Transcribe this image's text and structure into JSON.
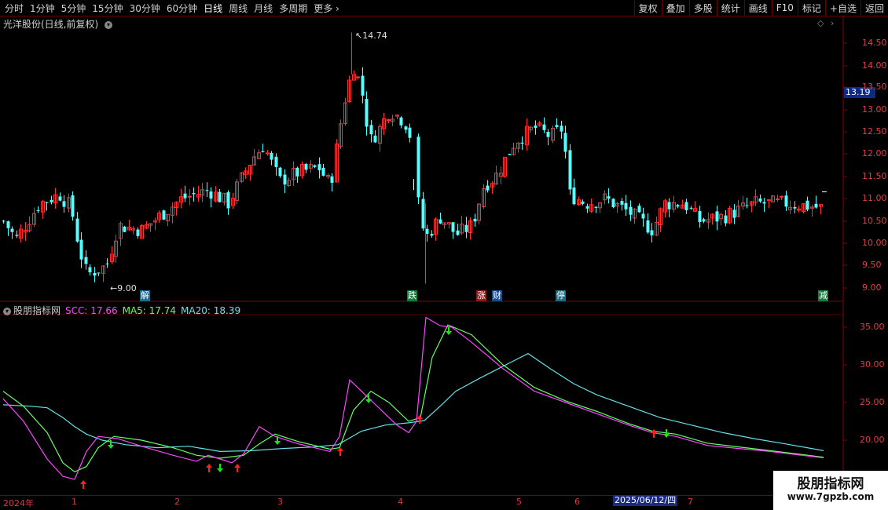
{
  "toolbar": {
    "periods": [
      "分时",
      "1分钟",
      "5分钟",
      "15分钟",
      "30分钟",
      "60分钟",
      "日线",
      "周线",
      "月线",
      "多周期",
      "更多"
    ],
    "active_period": "日线",
    "right_buttons": [
      "复权",
      "叠加",
      "多股",
      "统计",
      "画线",
      "F10",
      "标记",
      "+自选",
      "返回"
    ]
  },
  "main_chart": {
    "title": "光洋股份(日线,前复权)",
    "high_annotation": "14.74",
    "low_annotation": "9.00",
    "current_price": "13.19",
    "y_axis_labels": [
      "14.50",
      "14.00",
      "13.50",
      "13.00",
      "12.50",
      "12.00",
      "11.50",
      "11.00",
      "10.50",
      "10.00",
      "9.50",
      "9.00"
    ],
    "events": [
      {
        "label": "解",
        "color": "#1a6a8a"
      },
      {
        "label": "跌",
        "color": "#1a7a3a"
      },
      {
        "label": "涨",
        "color": "#8a1a1a"
      },
      {
        "label": "财",
        "color": "#1a4a8a"
      },
      {
        "label": "停",
        "color": "#1a6a8a"
      },
      {
        "label": "减",
        "color": "#1a7a3a"
      }
    ],
    "up_color": "#ff3030",
    "down_color": "#54ffff"
  },
  "indicator": {
    "name": "股朋指标网",
    "scc_label": "SCC: 17.66",
    "ma5_label": "MA5: 17.74",
    "ma20_label": "MA20: 18.39",
    "y_axis_labels": [
      "35.00",
      "30.00",
      "25.00",
      "20.00"
    ],
    "scc_color": "#ff44ff",
    "ma5_color": "#66ff66",
    "ma20_color": "#66e0e8"
  },
  "time_axis": {
    "labels": [
      "2024年",
      "1",
      "2",
      "3",
      "4",
      "5",
      "6",
      "7"
    ],
    "selected_date": "2025/06/12/四"
  },
  "watermark": {
    "title": "股朋指标网",
    "url": "www.7gpzb.com"
  }
}
